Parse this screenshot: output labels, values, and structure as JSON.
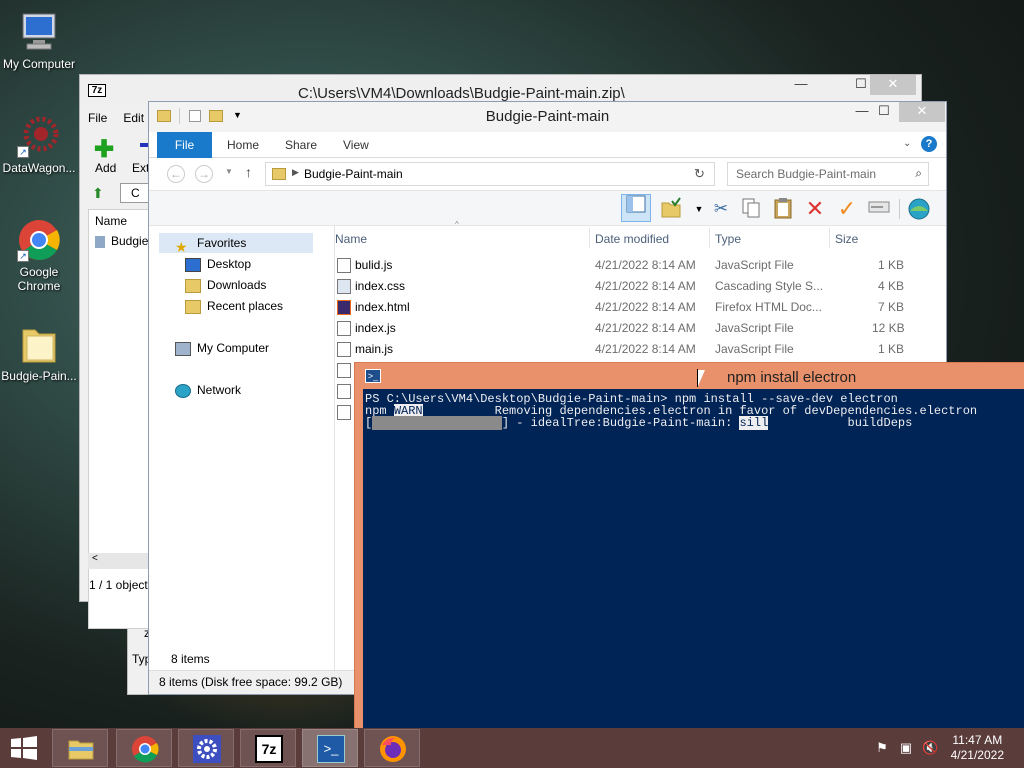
{
  "desktop": {
    "icons": [
      {
        "label": "My Computer"
      },
      {
        "label": "DataWagon..."
      },
      {
        "label": "Google Chrome"
      },
      {
        "label": "Budgie-Pain..."
      }
    ]
  },
  "sevenzip": {
    "icon_label": "7z",
    "title": "C:\\Users\\VM4\\Downloads\\Budgie-Paint-main.zip\\",
    "menu": [
      "File",
      "Edit"
    ],
    "toolbar": {
      "add": "Add",
      "extract": "Extr"
    },
    "list_header": "Name",
    "list_item": "Budgie",
    "status": "1 / 1 object",
    "behind_c": "C"
  },
  "bg_window": {
    "fragments": [
      "z",
      "Typ"
    ]
  },
  "explorer": {
    "title": "Budgie-Paint-main",
    "tabs": [
      "File",
      "Home",
      "Share",
      "View"
    ],
    "breadcrumb": "Budgie-Paint-main",
    "search_placeholder": "Search Budgie-Paint-main",
    "nav": {
      "favorites": "Favorites",
      "desktop": "Desktop",
      "downloads": "Downloads",
      "recent": "Recent places",
      "computer": "My Computer",
      "network": "Network"
    },
    "columns": [
      "Name",
      "Date modified",
      "Type",
      "Size"
    ],
    "files": [
      {
        "name": "bulid.js",
        "date": "4/21/2022 8:14 AM",
        "type": "JavaScript File",
        "size": "1 KB"
      },
      {
        "name": "index.css",
        "date": "4/21/2022 8:14 AM",
        "type": "Cascading Style S...",
        "size": "4 KB"
      },
      {
        "name": "index.html",
        "date": "4/21/2022 8:14 AM",
        "type": "Firefox HTML Doc...",
        "size": "7 KB"
      },
      {
        "name": "index.js",
        "date": "4/21/2022 8:14 AM",
        "type": "JavaScript File",
        "size": "12 KB"
      },
      {
        "name": "main.js",
        "date": "4/21/2022 8:14 AM",
        "type": "JavaScript File",
        "size": "1 KB"
      }
    ],
    "item_count": "8 items",
    "status": "8 items (Disk free space: 99.2 GB)"
  },
  "powershell": {
    "title": "npm install electron",
    "line1": "PS C:\\Users\\VM4\\Desktop\\Budgie-Paint-main> npm install --save-dev electron",
    "line2_a": "npm ",
    "line2_warn": "WARN",
    "line2_b": "          Removing dependencies.electron in favor of devDependencies.electron",
    "line3_a": "[",
    "line3_bar": "##################",
    "line3_b": "] - idealTree:Budgie-Paint-main: ",
    "line3_sill": "sill",
    "line3_c": "           buildDeps"
  },
  "taskbar": {
    "sevenzip_label": "7z",
    "time": "11:47 AM",
    "date": "4/21/2022"
  },
  "colors": {
    "explorer_file_tab": "#1979ca",
    "powershell_bg": "#012456",
    "powershell_frame": "#e8916a",
    "taskbar": "#5a3c3b"
  }
}
